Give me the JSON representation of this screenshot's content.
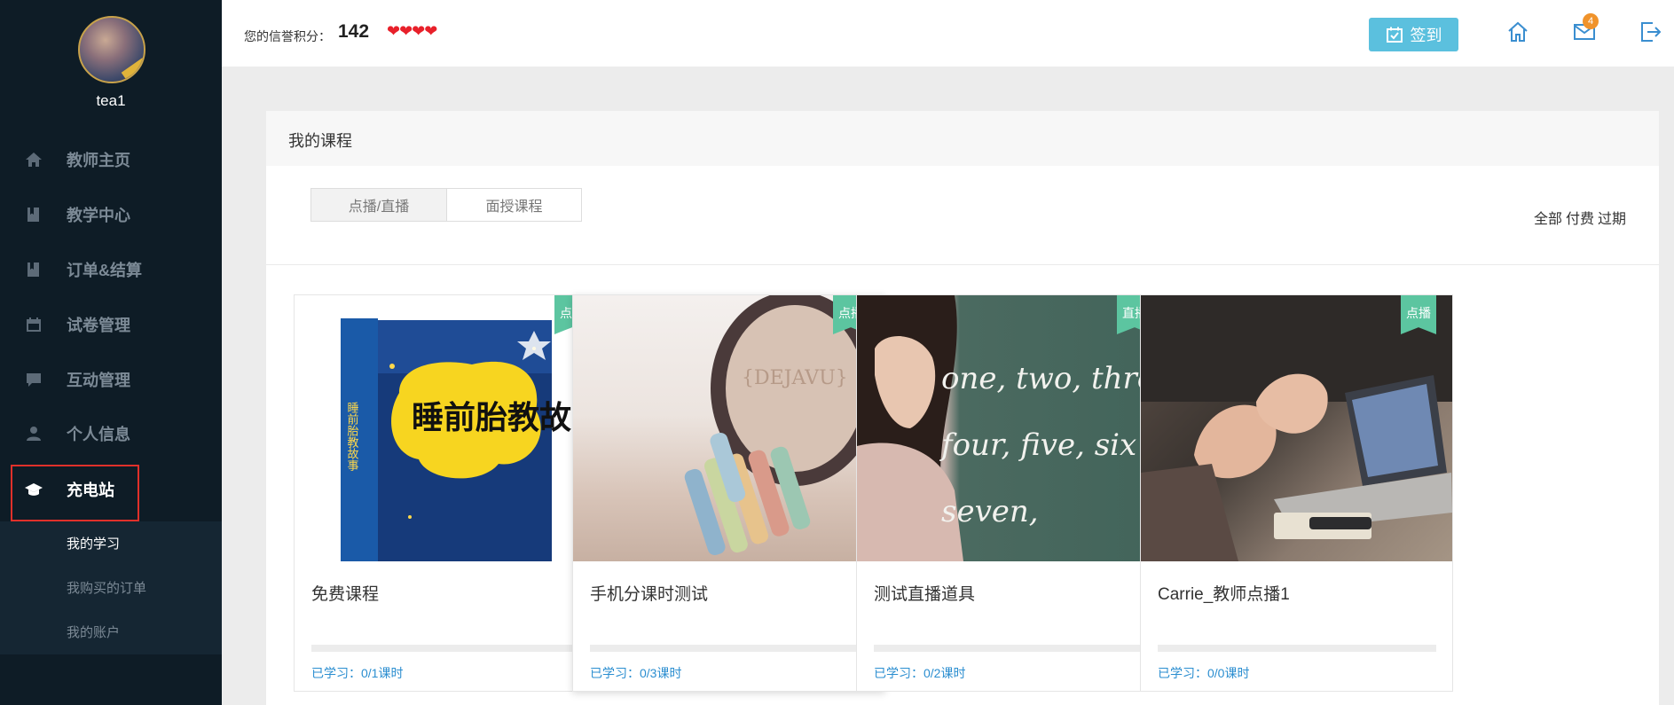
{
  "sidebar": {
    "username": "tea1",
    "items": [
      {
        "label": "教师主页",
        "icon": "home-icon"
      },
      {
        "label": "教学中心",
        "icon": "book-icon"
      },
      {
        "label": "订单&结算",
        "icon": "book-icon"
      },
      {
        "label": "试卷管理",
        "icon": "calendar-icon"
      },
      {
        "label": "互动管理",
        "icon": "chat-icon"
      },
      {
        "label": "个人信息",
        "icon": "user-icon"
      },
      {
        "label": "充电站",
        "icon": "graduation-cap-icon"
      }
    ],
    "active_item": "充电站",
    "sub_items": [
      {
        "label": "我的学习"
      },
      {
        "label": "我购买的订单"
      },
      {
        "label": "我的账户"
      }
    ],
    "current_sub_item": "我的学习"
  },
  "topbar": {
    "credit_label": "您的信誉积分：",
    "credit_value": "142",
    "hearts": "❤❤❤❤",
    "signin_label": "签到",
    "mail_badge": "4"
  },
  "main": {
    "title": "我的课程",
    "tabs": [
      {
        "label": "点播/直播"
      },
      {
        "label": "面授课程"
      }
    ],
    "filters": [
      "全部",
      "付费",
      "过期"
    ],
    "courses": [
      {
        "title": "免费课程",
        "tag": "点播",
        "studied": "已学习：0/1课时",
        "progress": 0,
        "image": "bedtime-story-book"
      },
      {
        "title": "手机分课时测试",
        "tag": "点播",
        "studied": "已学习：0/3课时",
        "progress": 0,
        "image": "chalk-cup"
      },
      {
        "title": "测试直播道具",
        "tag": "直播",
        "studied": "已学习：0/2课时",
        "progress": 0,
        "image": "girl-chalkboard"
      },
      {
        "title": "Carrie_教师点播1",
        "tag": "点播",
        "studied": "已学习：0/0课时",
        "progress": 0,
        "image": "laptop-discussion"
      }
    ],
    "book_cover": {
      "title": "睡前胎教故事",
      "spine": "睡前胎教故事"
    },
    "cup_text": "{DEJAVU}",
    "board_text": [
      "one, two, thre",
      "four, five, six",
      "seven,"
    ]
  },
  "colors": {
    "sidebar_bg": "#0e1c26",
    "accent_blue": "#5bc0de",
    "tag_green": "#5cc5a0",
    "highlight_red": "#e0302a",
    "link_blue": "#2b8ed0"
  }
}
